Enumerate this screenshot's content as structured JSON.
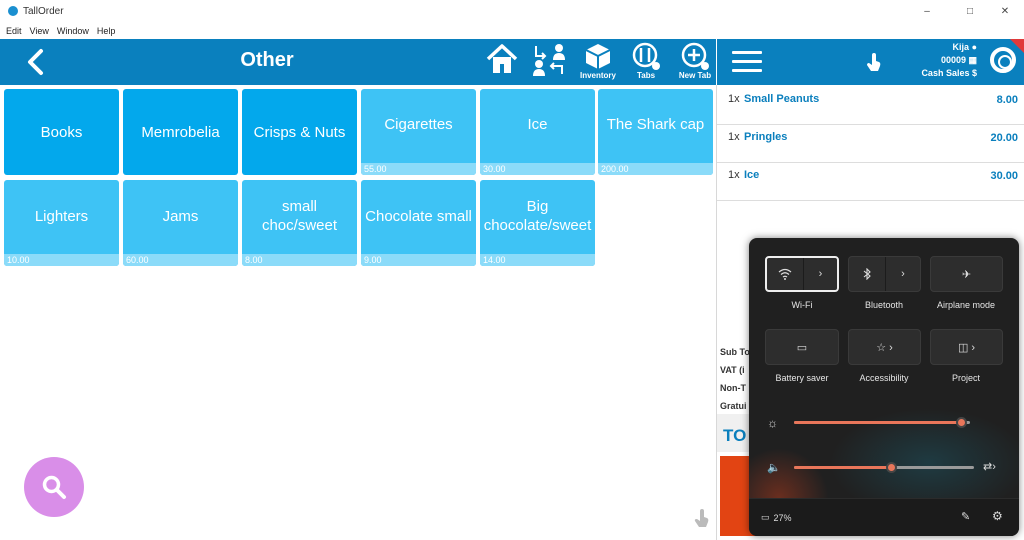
{
  "window": {
    "title": "TallOrder"
  },
  "menu": [
    "Edit",
    "View",
    "Window",
    "Help"
  ],
  "header": {
    "title": "Other",
    "tools": {
      "inventory": "Inventory",
      "tabs": "Tabs",
      "new_tab": "New Tab"
    }
  },
  "products": [
    {
      "name": "Books",
      "price": ""
    },
    {
      "name": "Memrobelia",
      "price": ""
    },
    {
      "name": "Crisps & Nuts",
      "price": ""
    },
    {
      "name": "Cigarettes",
      "price": "55.00"
    },
    {
      "name": "Ice",
      "price": "30.00"
    },
    {
      "name": "The Shark cap",
      "price": "200.00"
    },
    {
      "name": "Lighters",
      "price": "10.00"
    },
    {
      "name": "Jams",
      "price": "60.00"
    },
    {
      "name": "small choc/sweet",
      "price": "8.00"
    },
    {
      "name": "Chocolate small",
      "price": "9.00"
    },
    {
      "name": "Big chocolate/sweet",
      "price": "14.00"
    }
  ],
  "order_header": {
    "user": "Kija",
    "order_no": "00009",
    "mode": "Cash Sales"
  },
  "order_lines": [
    {
      "qty": "1x",
      "item": "Small Peanuts",
      "amount": "8.00"
    },
    {
      "qty": "1x",
      "item": "Pringles",
      "amount": "20.00"
    },
    {
      "qty": "1x",
      "item": "Ice",
      "amount": "30.00"
    }
  ],
  "totals": {
    "sub_total": "Sub To",
    "vat": "VAT (i",
    "non_taxable": "Non-T",
    "gratuity": "Gratui",
    "total": "TO"
  },
  "quick_settings": {
    "wifi": "Wi-Fi",
    "bluetooth": "Bluetooth",
    "airplane": "Airplane mode",
    "battery_saver": "Battery saver",
    "accessibility": "Accessibility",
    "project": "Project",
    "battery": "27%",
    "brightness": 0.95,
    "volume": 0.54
  }
}
